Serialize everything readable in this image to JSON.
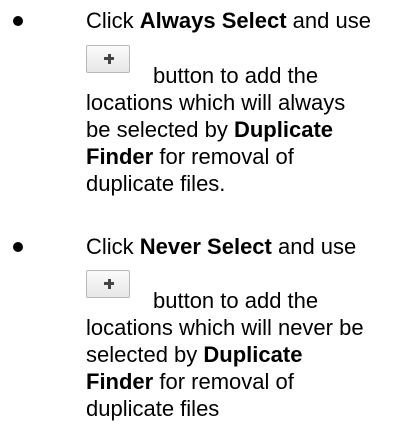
{
  "items": [
    {
      "line1": {
        "pre": "Click ",
        "bold": "Always Select",
        "post": " and use"
      },
      "button_text": "button to add the",
      "line3": "locations which will always",
      "line4": {
        "pre": "be selected by ",
        "bold": "Duplicate"
      },
      "line5": {
        "bold": "Finder",
        "post": " for removal of"
      },
      "line6": "duplicate files.",
      "button_icon": "plus-icon"
    },
    {
      "line1": {
        "pre": "Click ",
        "bold": "Never Select",
        "post": " and use"
      },
      "button_text": "button to add the",
      "line3": "locations which will never be",
      "line4": {
        "pre": "selected by ",
        "bold": "Duplicate"
      },
      "line5": {
        "bold": "Finder",
        "post": " for removal of"
      },
      "line6": "duplicate files",
      "button_icon": "plus-icon"
    }
  ]
}
